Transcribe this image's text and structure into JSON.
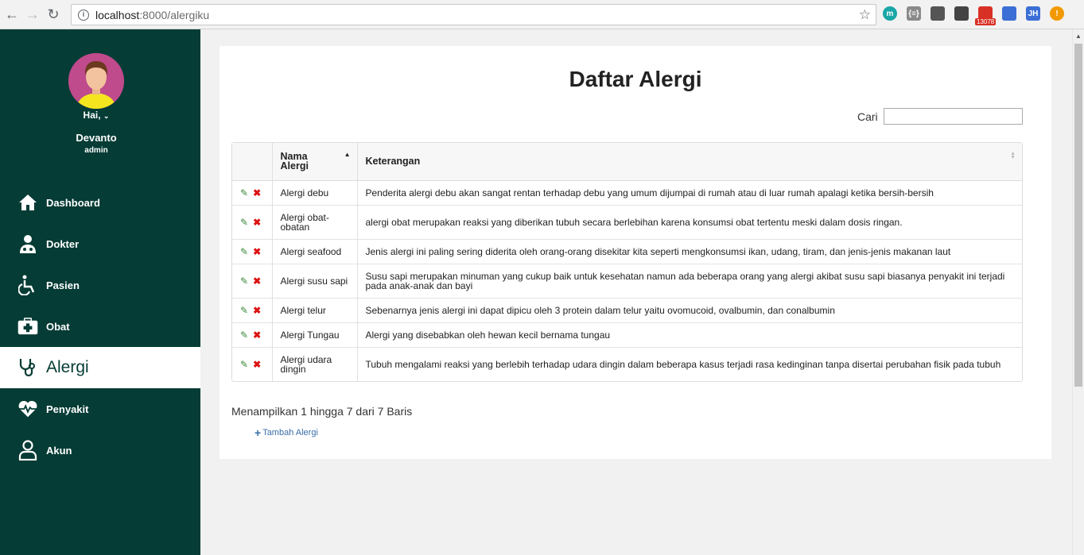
{
  "browser": {
    "url_host": "localhost",
    "url_path": ":8000/alergiku",
    "extensions": [
      {
        "name": "m-extension",
        "label": "m",
        "color": "#1aa6a6"
      },
      {
        "name": "json-extension",
        "label": "{≡}",
        "color": "#8a8a8a"
      },
      {
        "name": "profile-extension",
        "label": "",
        "color": "#555555"
      },
      {
        "name": "chat-extension",
        "label": "",
        "color": "#444444"
      },
      {
        "name": "gmail-extension",
        "label": "",
        "color": "#d93025",
        "badge": "13078"
      },
      {
        "name": "calendar-extension",
        "label": "",
        "color": "#3b6fd6"
      },
      {
        "name": "jh-extension",
        "label": "JH",
        "color": "#3b6fd6"
      },
      {
        "name": "alert-extension",
        "label": "!",
        "color": "#f29900"
      }
    ]
  },
  "user": {
    "greeting": "Hai,",
    "name": "Devanto",
    "role": "admin"
  },
  "menu": [
    {
      "label": "Dashboard",
      "icon": "home-icon"
    },
    {
      "label": "Dokter",
      "icon": "doctor-icon"
    },
    {
      "label": "Pasien",
      "icon": "wheelchair-icon"
    },
    {
      "label": "Obat",
      "icon": "medkit-icon"
    },
    {
      "label": "Alergi",
      "icon": "stethoscope-icon",
      "active": true
    },
    {
      "label": "Penyakit",
      "icon": "heartbeat-icon"
    },
    {
      "label": "Akun",
      "icon": "user-icon"
    }
  ],
  "page": {
    "title": "Daftar Alergi",
    "search_label": "Cari",
    "info": "Menampilkan 1 hingga 7 dari 7 Baris",
    "add_label": "Tambah Alergi"
  },
  "table": {
    "headers": [
      "",
      "Nama Alergi",
      "Keterangan"
    ],
    "rows": [
      {
        "name": "Alergi debu",
        "desc": "Penderita alergi debu akan sangat rentan terhadap debu yang umum dijumpai di rumah atau di luar rumah apalagi ketika bersih-bersih"
      },
      {
        "name": "Alergi obat-obatan",
        "desc": "alergi obat merupakan reaksi yang diberikan tubuh secara berlebihan karena konsumsi obat tertentu meski dalam dosis ringan."
      },
      {
        "name": "Alergi seafood",
        "desc": "Jenis alergi ini paling sering diderita oleh orang-orang disekitar kita seperti mengkonsumsi ikan, udang, tiram, dan jenis-jenis makanan laut"
      },
      {
        "name": "Alergi susu sapi",
        "desc": "Susu sapi merupakan minuman yang cukup baik untuk kesehatan namun ada beberapa orang yang alergi akibat susu sapi biasanya penyakit ini terjadi pada anak-anak dan bayi"
      },
      {
        "name": "Alergi telur",
        "desc": "Sebenarnya jenis alergi ini dapat dipicu oleh 3 protein dalam telur yaitu ovomucoid, ovalbumin, dan conalbumin"
      },
      {
        "name": "Alergi Tungau",
        "desc": "Alergi yang disebabkan oleh hewan kecil bernama tungau"
      },
      {
        "name": "Alergi udara dingin",
        "desc": "Tubuh mengalami reaksi yang berlebih terhadap udara dingin dalam beberapa kasus terjadi rasa kedinginan tanpa disertai perubahan fisik pada tubuh"
      }
    ]
  }
}
